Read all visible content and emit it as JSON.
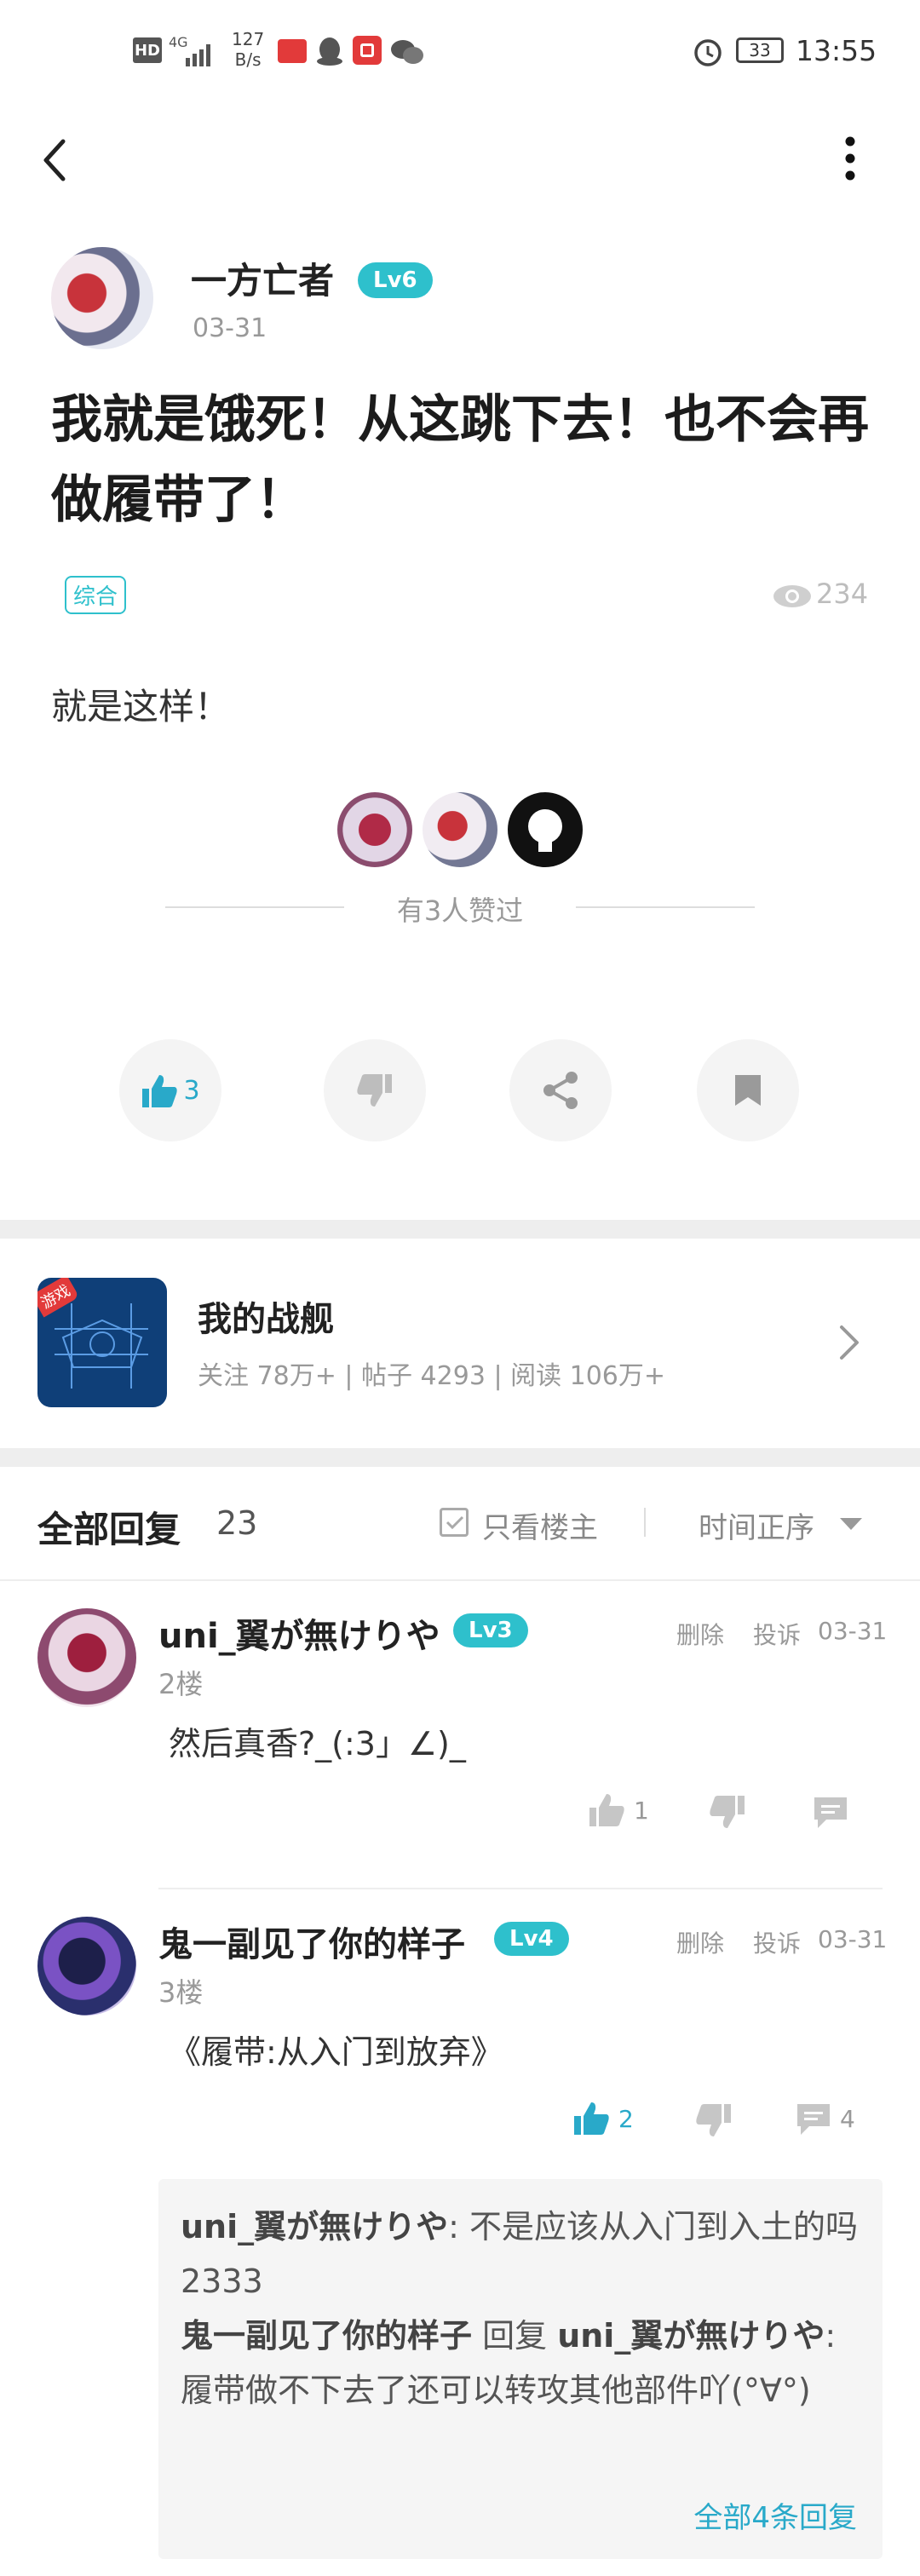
{
  "status_bar": {
    "hd": "HD",
    "net": "4G",
    "speed_value": "127",
    "speed_unit": "B/s",
    "battery": "33",
    "time": "13:55"
  },
  "post": {
    "author": "一方亡者",
    "level": "Lv6",
    "date": "03-31",
    "title": "我就是饿死！从这跳下去！也不会再做履带了！",
    "tag": "综合",
    "views": "234",
    "body": "就是这样！",
    "likes_text": "有3人赞过",
    "like_count": "3"
  },
  "forum": {
    "name": "我的战舰",
    "stats": "关注 78万+ | 帖子 4293 | 阅读 106万+",
    "badge": "游戏"
  },
  "replies_header": {
    "title": "全部回复",
    "count": "23",
    "only_owner": "只看楼主",
    "sort": "时间正序"
  },
  "comments": [
    {
      "user": "uni_翼が無けりや",
      "level": "Lv3",
      "floor": "2楼",
      "delete": "删除",
      "report": "投诉",
      "date": "03-31",
      "text": "然后真香?_(:3」∠)_",
      "likes": "1",
      "replies": ""
    },
    {
      "user": "鬼一副见了你的样子",
      "level": "Lv4",
      "floor": "3楼",
      "delete": "删除",
      "report": "投诉",
      "date": "03-31",
      "text": "《履带:从入门到放弃》",
      "likes": "2",
      "replies": "4"
    }
  ],
  "sub_replies": {
    "r1_user": "uni_翼が無けりや",
    "r1_text": ": 不是应该从入门到入土的吗2333",
    "r2_user": "鬼一副见了你的样子",
    "r2_mid": " 回复 ",
    "r2_target": "uni_翼が無けりや",
    "r2_text": ": 履带做不下去了还可以转攻其他部件吖(°∀°)",
    "all": "全部4条回复"
  },
  "colors": {
    "accent": "#2ec0cc",
    "like_active": "#29a9c9"
  }
}
